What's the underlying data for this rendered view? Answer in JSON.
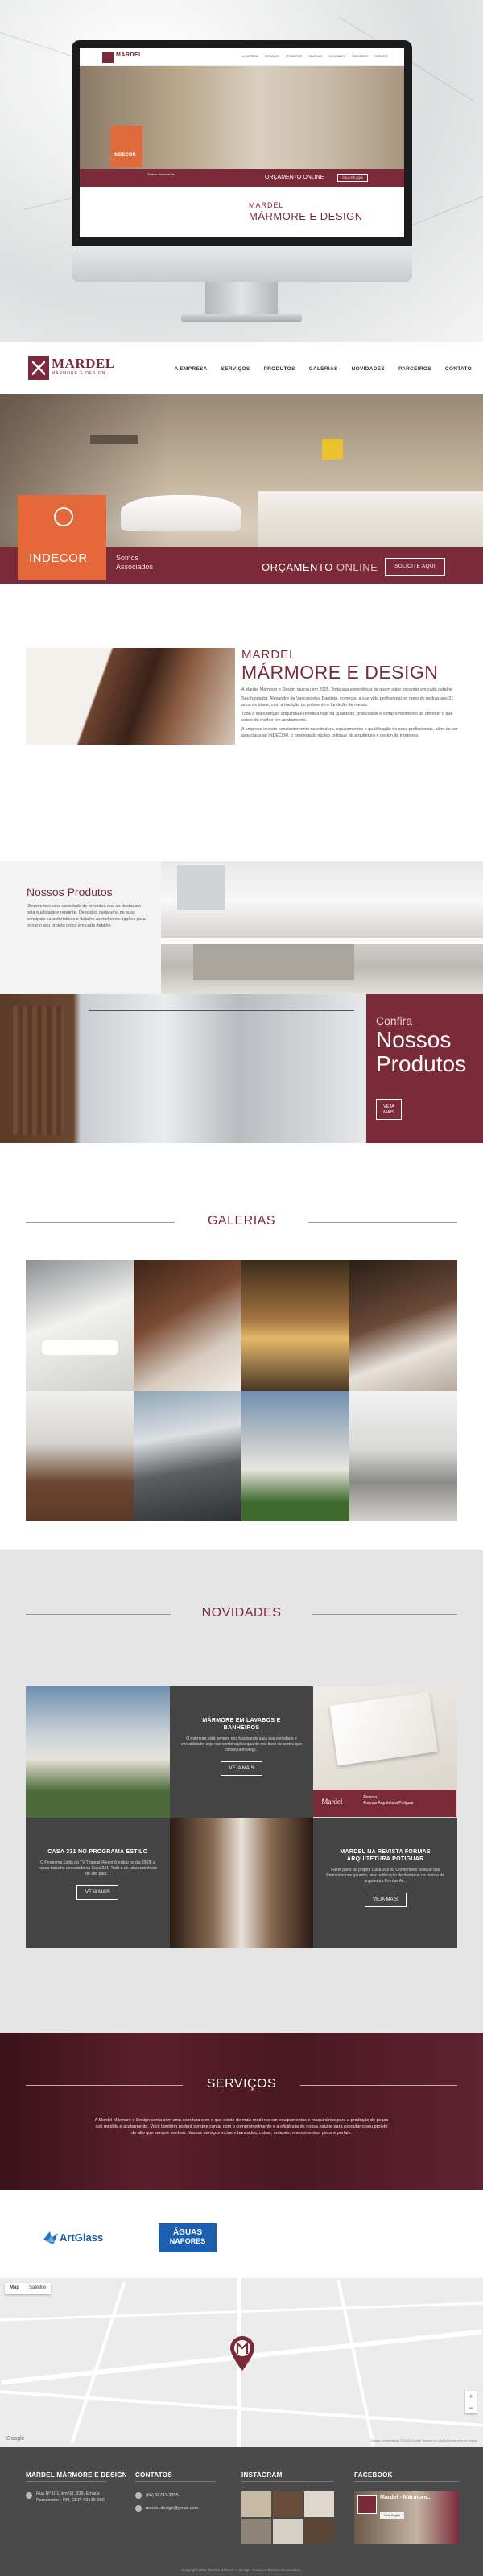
{
  "mockup": {
    "mini_logo": "MARDEL",
    "mini_menu": [
      "A EMPRESA",
      "SERVIÇOS",
      "PRODUTOS",
      "GALERIAS",
      "NOVIDADES",
      "PARCEIROS",
      "CONTATO"
    ],
    "indecor": "INDECOR",
    "assoc": "Somos Associados",
    "orcamento": "ORÇAMENTO ONLINE",
    "solicite": "SOLICITE AQUI",
    "title_small": "MARDEL",
    "title_big": "MÁRMORE E DESIGN"
  },
  "header": {
    "logo_name": "MARDEL",
    "logo_sub": "MÁRMORE E DESIGN",
    "menu": [
      "A EMPRESA",
      "SERVIÇOS",
      "PRODUTOS",
      "GALERIAS",
      "NOVIDADES",
      "PARCEIROS",
      "CONTATO"
    ]
  },
  "hero": {
    "indecor_label": "INDECOR",
    "assoc_line1": "Somos",
    "assoc_line2": "Associados",
    "orcamento_bold": "ORÇAMENTO",
    "orcamento_light": "ONLINE",
    "solicite_button": "SOLICITE AQUI"
  },
  "about": {
    "title_small": "MARDEL",
    "title_big": "MÁRMORE E DESIGN",
    "paragraphs": [
      "A Mardel Mármore e Design nasceu em 2005. Toda sua experiência de quem sabe encantar em cada detalhe.",
      "Seu fundador, Alexandre de Vasconcelos Baptista, começou a sua vida profissional no ramo de pedras aos 21 anos de idade, com a tradição do polimento e fundição de metais.",
      "Toda a manutenção adquirida é refletida hoje na qualidade, praticidade e comprometimento de oferecer o que existe de melhor em acabamento.",
      "A empresa investe constantemente na estrutura, equipamentos e qualificação de seus profissionais, além de ser associada ao INDECOR, o privilegiado núcleo potiguar de arquitetura e design de interiores."
    ]
  },
  "products": {
    "title": "Nossos Produtos",
    "text": "Oferecemos uma variedade de produtos que se destacam pela qualidade e requinte. Descubra cada uma de suas principais características e detalhe as melhores opções para tornar o seu projeto único em cada detalhe.",
    "cta_small": "Confira",
    "cta_big_1": "Nossos",
    "cta_big_2": "Produtos",
    "cta_button_1": "VEJA",
    "cta_button_2": "MAIS"
  },
  "galleries": {
    "title": "GALERIAS"
  },
  "news": {
    "title": "NOVIDADES",
    "card1_title": "MÁRMORE EM LAVABOS E BANHEIROS",
    "card1_text": "O mármore está sempre nos fascinando para sua variedade e versatilidade, seja nas combinações quanto nos tipos de cortes que conseguem elegi...",
    "card1_button": "VEJA MAIS",
    "card2_title": "CASA 331 NO PROGRAMA ESTILO",
    "card2_text": "O Programa Estilo da TV Tropical (Record) exibiu no dia 29/08 a nossa trabalho executado na Casa 331. Toda a de uma residência de alto padr...",
    "card2_button": "VEJA MAIS",
    "card3_title": "MARDEL NA REVISTA FORMAS ARQUITETURA POTIGUAR",
    "card3_text": "Fazer parte do projeto Casa 308 no Condomínio Bosque das Palmeiras nos garantiu uma publicação de destaque na revista de arquitetura Formas Ar...",
    "card3_button": "VEJA MAIS",
    "revista_brand": "Mardel",
    "revista_line1": "Revista",
    "revista_line2": "Formas Arquitetura Potiguar"
  },
  "services": {
    "title": "SERVIÇOS",
    "text": "A Mardel Mármore e Design conta com uma estrutura com o que existe de mais moderno em equipamentos e maquinários para a produção de peças sob medida e acabamento. Você também poderá sempre contar com o comprometimento e a eficiência de nossa equipe para executar o seu projeto de alto que sempre sonhou. Nossos serviços incluem bancadas, cubas, rodapés, revestimentos, pisos e portais."
  },
  "partners": {
    "artglass": "ArtGlass",
    "aguas_1": "ÁGUAS",
    "aguas_2": "NAPORES"
  },
  "map": {
    "toggle": [
      "Map",
      "Satellite"
    ],
    "google": "Google",
    "legal": "Dados cartográficos ©2016 Google  Termos de Uso  Informar erro no mapa"
  },
  "footer": {
    "col1_title": "MARDEL MÁRMORE E DESIGN",
    "address_1": "Rua Nº 101, km 08, 839, Emaús",
    "address_2": "Parnamirim - RN, CEP: 59149-090",
    "col2_title": "CONTATOS",
    "phone": "(84) 98741-3355",
    "email": "mardel.design@gmail.com",
    "col3_title": "INSTAGRAM",
    "col4_title": "FACEBOOK",
    "fb_name": "Mardel - Mármore...",
    "fb_btn": "Curtir Página",
    "copyright": "Copyright 2016, Mardel Mármore e Design. Todos os Direitos Reservados."
  },
  "colors": {
    "brand": "#7b2a3a",
    "indecor_orange": "#e4683a",
    "dark_card": "#444444",
    "footer_bg": "#4a4a4a",
    "aguas_blue": "#1c5fae"
  },
  "icons": [
    "map-pin-icon",
    "phone-icon",
    "mail-icon",
    "indecor-icon"
  ]
}
